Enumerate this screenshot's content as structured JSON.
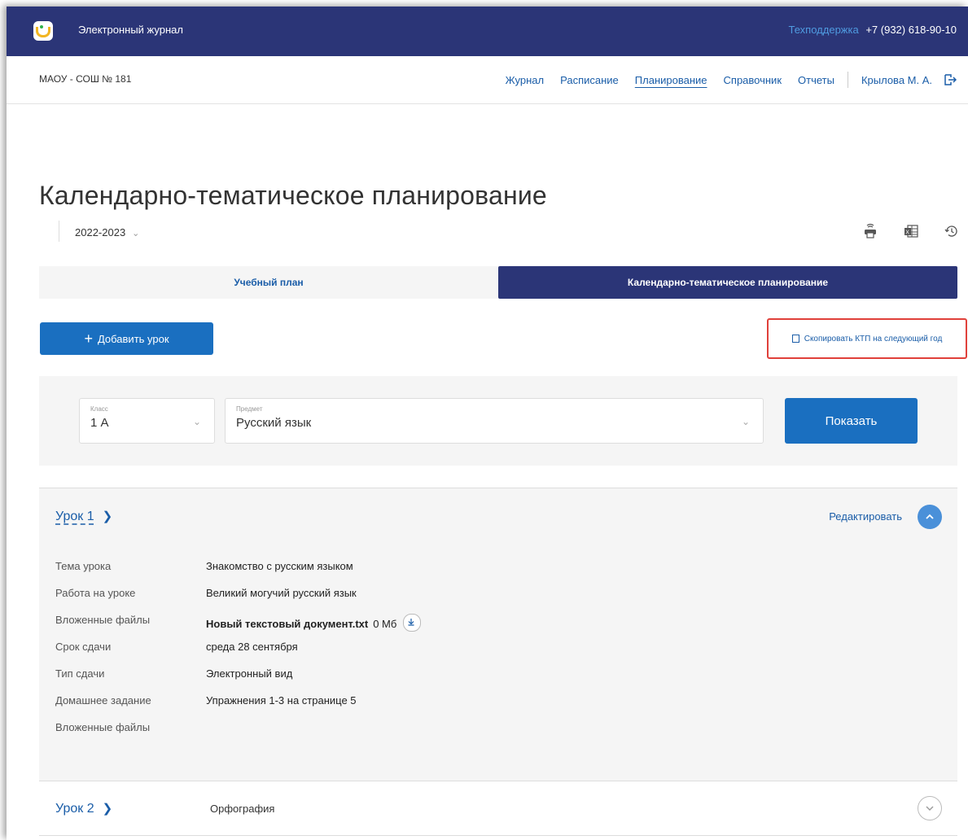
{
  "header": {
    "app_title": "Электронный журнал",
    "support_label": "Техподдержка",
    "support_phone": "+7 (932) 618-90-10"
  },
  "navbar": {
    "school": "МАОУ - СОШ № 181",
    "items": [
      "Журнал",
      "Расписание",
      "Планирование",
      "Справочник",
      "Отчеты"
    ],
    "active_item": "Планирование",
    "user": "Крылова М. А."
  },
  "page": {
    "title": "Календарно-тематическое планирование",
    "year": "2022-2023",
    "tools": [
      "print-icon",
      "excel-icon",
      "history-icon"
    ]
  },
  "tabs": [
    {
      "label": "Учебный план",
      "active": false
    },
    {
      "label": "Календарно-тематическое планирование",
      "active": true
    }
  ],
  "actions": {
    "add_lesson": "Добавить урок",
    "copy_ktp": "Скопировать КТП на следующий год"
  },
  "filter": {
    "class_caption": "Класс",
    "class_value": "1 А",
    "subject_caption": "Предмет",
    "subject_value": "Русский язык",
    "show_button": "Показать"
  },
  "lessons": [
    {
      "title": "Урок 1",
      "edit_label": "Редактировать",
      "expanded": true,
      "fields": [
        {
          "label": "Тема урока",
          "value": "Знакомство с русским языком"
        },
        {
          "label": "Работа на уроке",
          "value": "Великий могучий русский язык"
        },
        {
          "label": "Вложенные файлы",
          "file_name": "Новый текстовый документ.txt",
          "file_size": "0 Мб"
        },
        {
          "label": "Срок сдачи",
          "value": "среда 28 сентября"
        },
        {
          "label": "Тип сдачи",
          "value": "Электронный вид"
        },
        {
          "label": "Домашнее задание",
          "value": "Упражнения 1-3 на странице 5"
        },
        {
          "label": "Вложенные файлы",
          "value": ""
        }
      ]
    },
    {
      "title": "Урок 2",
      "topic": "Орфография",
      "expanded": false
    }
  ],
  "colors": {
    "header_bg": "#2b3577",
    "primary": "#1a6fc0",
    "link": "#1a5da8",
    "highlight_border": "#e0403a"
  }
}
